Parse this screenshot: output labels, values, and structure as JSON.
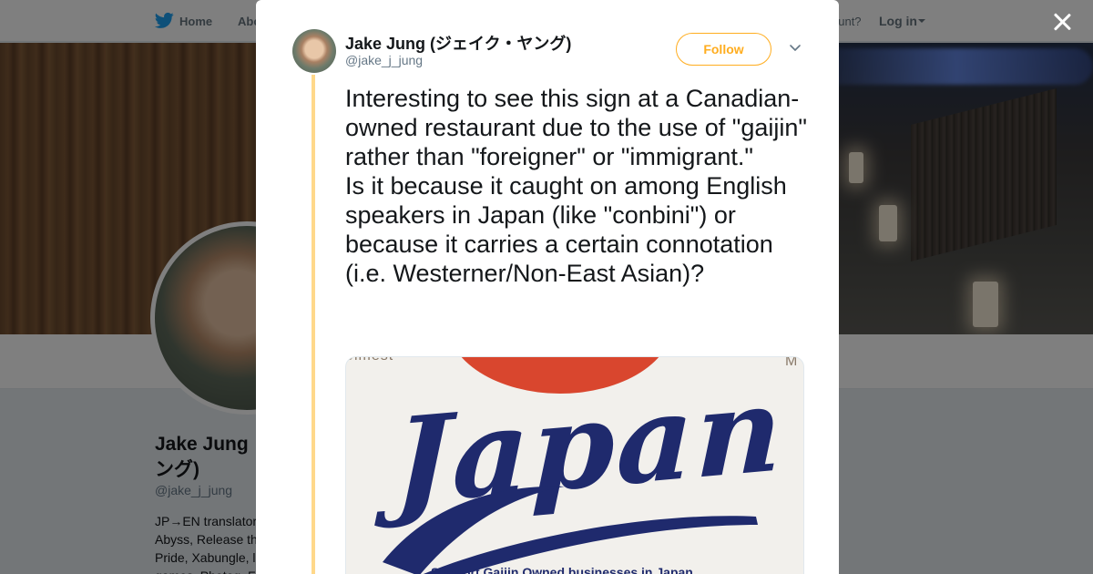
{
  "background_page": {
    "nav": {
      "home_label": "Home",
      "about_label": "Abo",
      "account_prompt": "ccount?",
      "login_label": "Log in"
    },
    "profile": {
      "name": "Jake Jung (ジェイク・ヤングング)",
      "name_line1": "Jake Jung",
      "name_line2": "ング)",
      "handle": "@jake_j_jung",
      "bio": "JP→EN translator Abyss, Release th Pride, Xabungle, l games, Photog, F"
    }
  },
  "modal": {
    "author": {
      "name": "Jake Jung (ジェイク・ヤング)",
      "handle": "@jake_j_jung"
    },
    "follow_label": "Follow",
    "tweet_text": "Interesting to see this sign at a Canadian-owned restaurant due to the use of \"gaijin\" rather than \"foreigner\" or \"immigrant.\"\nIs it because it caught on among English speakers in Japan (like \"conbini\") or because it carries a certain connotation (i.e. Westerner/Non-East Asian)?",
    "media": {
      "headline": "Japan",
      "caption": "Support Gaijin Owned businesses in Japan",
      "crop_top": "Jimest",
      "crop_right": "M"
    }
  },
  "icons": {
    "brand": "twitter-bird-icon",
    "close": "close-icon",
    "more": "chevron-down-icon",
    "login_caret": "caret-down-icon"
  },
  "colors": {
    "accent": "#ffad1f",
    "thread_line": "#ffd88a",
    "twitter_blue": "#1da1f2",
    "text": "#14171a",
    "muted": "#657786"
  }
}
